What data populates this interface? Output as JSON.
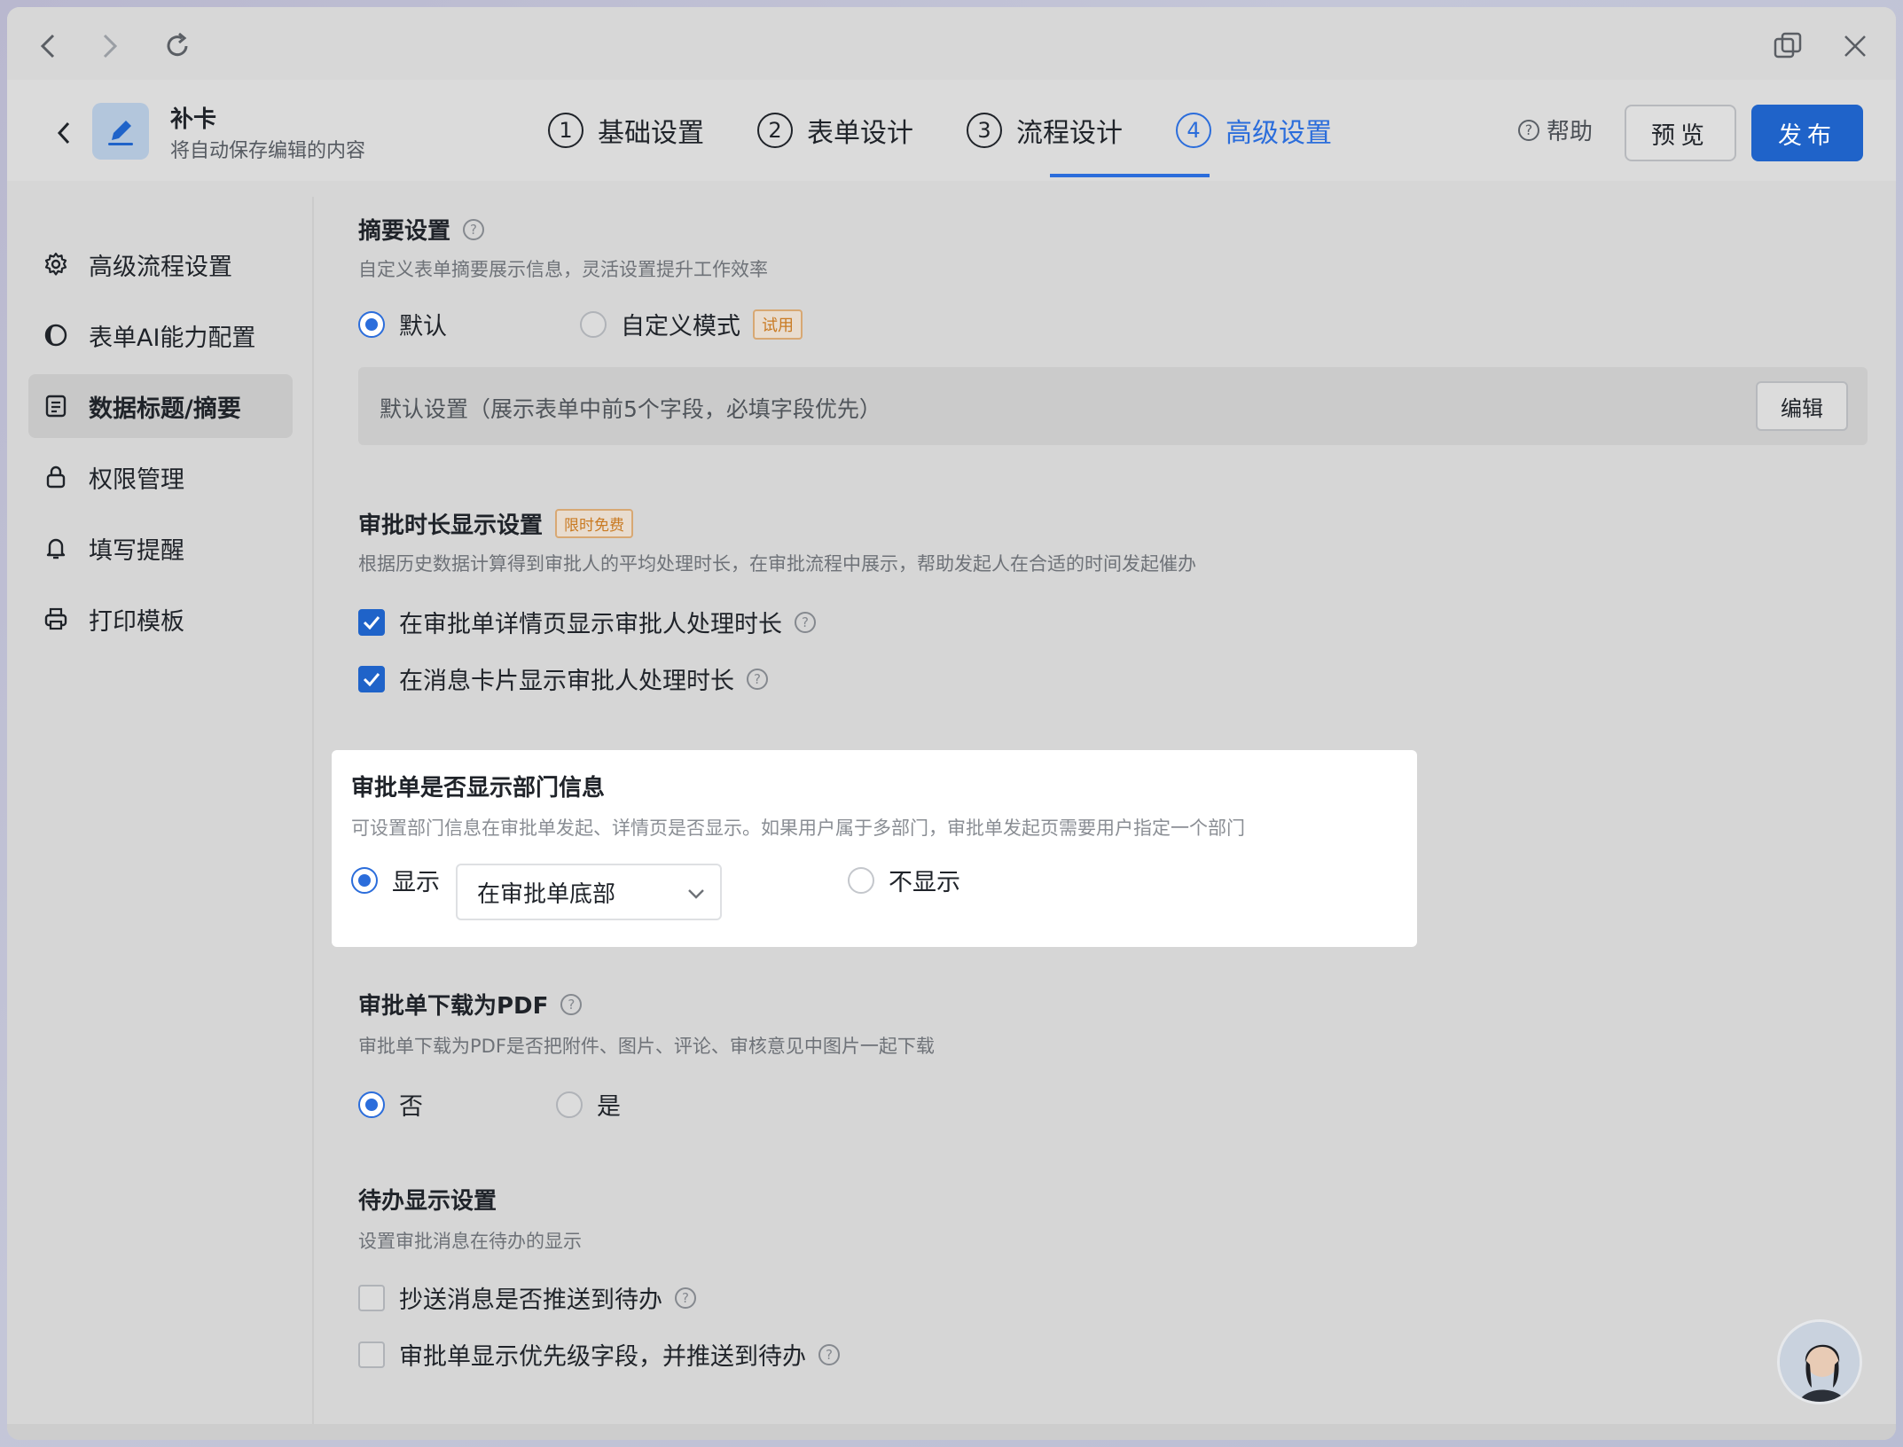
{
  "app": {
    "title": "补卡",
    "subtitle": "将自动保存编辑的内容"
  },
  "steps": [
    {
      "num": "1",
      "label": "基础设置"
    },
    {
      "num": "2",
      "label": "表单设计"
    },
    {
      "num": "3",
      "label": "流程设计"
    },
    {
      "num": "4",
      "label": "高级设置"
    }
  ],
  "header_actions": {
    "help": "帮助",
    "preview": "预览",
    "publish": "发布"
  },
  "sidebar": {
    "items": [
      {
        "label": "高级流程设置",
        "icon": "gear-icon"
      },
      {
        "label": "表单AI能力配置",
        "icon": "ai-icon"
      },
      {
        "label": "数据标题/摘要",
        "icon": "document-icon"
      },
      {
        "label": "权限管理",
        "icon": "lock-icon"
      },
      {
        "label": "填写提醒",
        "icon": "bell-icon"
      },
      {
        "label": "打印模板",
        "icon": "printer-icon"
      }
    ]
  },
  "summary": {
    "title": "摘要设置",
    "desc": "自定义表单摘要展示信息，灵活设置提升工作效率",
    "option_default": "默认",
    "option_custom": "自定义模式",
    "trial_tag": "试用",
    "box_text": "默认设置（展示表单中前5个字段，必填字段优先）",
    "edit_button": "编辑"
  },
  "duration": {
    "title": "审批时长显示设置",
    "tag": "限时免费",
    "desc": "根据历史数据计算得到审批人的平均处理时长，在审批流程中展示，帮助发起人在合适的时间发起催办",
    "check1": "在审批单详情页显示审批人处理时长",
    "check2": "在消息卡片显示审批人处理时长"
  },
  "department": {
    "title": "审批单是否显示部门信息",
    "desc": "可设置部门信息在审批单发起、详情页是否显示。如果用户属于多部门，审批单发起页需要用户指定一个部门",
    "option_show": "显示",
    "select_value": "在审批单底部",
    "option_hide": "不显示"
  },
  "pdf": {
    "title": "审批单下载为PDF",
    "desc": "审批单下载为PDF是否把附件、图片、评论、审核意见中图片一起下载",
    "option_no": "否",
    "option_yes": "是"
  },
  "todo": {
    "title": "待办显示设置",
    "desc": "设置审批消息在待办的显示",
    "check1": "抄送消息是否推送到待办",
    "check2": "审批单显示优先级字段，并推送到待办"
  },
  "colors": {
    "accent": "#2b6ddb",
    "publish": "#1f63c9",
    "trial_tag": "#c97a22"
  }
}
